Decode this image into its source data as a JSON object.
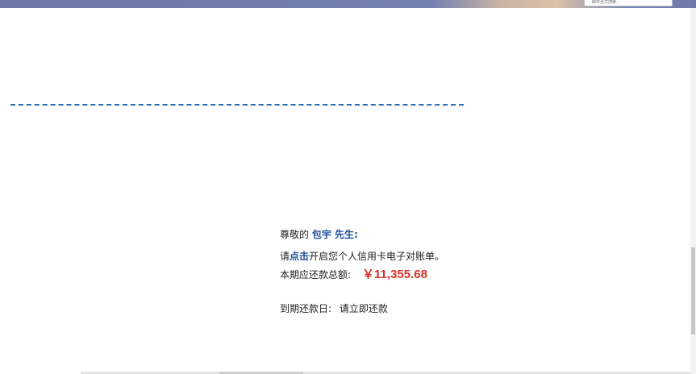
{
  "browser": {
    "search_placeholder": "邮件全文搜索..."
  },
  "statement": {
    "greeting_prefix": "尊敬的",
    "customer_name": "包宇 先生",
    "greeting_suffix": ":",
    "open_prefix": "请",
    "open_link": "点击",
    "open_suffix": "开启您个人信用卡电子对账单。",
    "amount_label": "本期应还款总额:",
    "amount_value": "￥11,355.68",
    "due_label": "到期还款日:",
    "due_value": "请立即还款"
  },
  "colors": {
    "accent_blue": "#1e4f9a",
    "amount_red": "#d6322a",
    "divider_blue": "#2f6fb0"
  }
}
